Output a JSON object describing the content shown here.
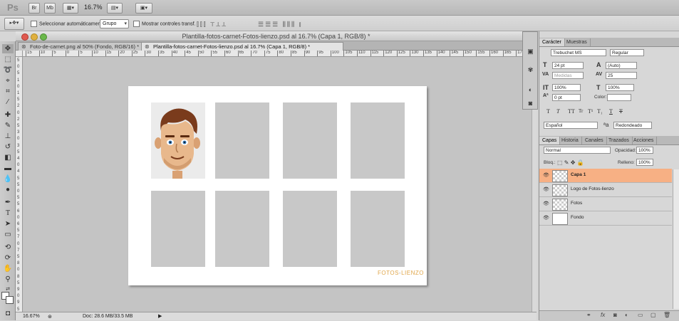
{
  "appbar": {
    "logo": "Ps",
    "br_button": "Br",
    "mb_button": "Mb",
    "zoom": "16.7%"
  },
  "options": {
    "auto_select_label": "Seleccionar automáticamente:",
    "group_value": "Grupo",
    "show_transform_label": "Mostrar controles transf."
  },
  "window": {
    "title": "Plantilla-fotos-carnet-Fotos-lienzo.psd al 16.7% (Capa 1, RGB/8) *"
  },
  "tabs": [
    {
      "label": "Foto-de-carnet.png al 50% (Fondo, RGB/16) *"
    },
    {
      "label": "Plantilla-fotos-carnet-Fotos-lienzo.psd al 16.7% (Capa 1, RGB/8) *"
    }
  ],
  "ruler": {
    "top": [
      "15",
      "10",
      "5",
      "0",
      "5",
      "10",
      "15",
      "20",
      "25",
      "30",
      "35",
      "40",
      "45",
      "50",
      "55",
      "60",
      "65",
      "70",
      "75",
      "80",
      "85",
      "90",
      "95",
      "100",
      "105",
      "110",
      "115",
      "120",
      "125",
      "130",
      "135",
      "140",
      "145",
      "150",
      "155",
      "160",
      "165",
      "170",
      "175"
    ],
    "left": [
      "5",
      "0",
      "5",
      "1",
      "0",
      "1",
      "5",
      "2",
      "0",
      "2",
      "5",
      "3",
      "0",
      "3",
      "5",
      "4",
      "0",
      "4",
      "5",
      "5",
      "0",
      "5",
      "5",
      "6",
      "0",
      "6",
      "5",
      "7",
      "0",
      "7",
      "5",
      "8",
      "0",
      "8",
      "5",
      "9",
      "0",
      "9",
      "5"
    ]
  },
  "document": {
    "logo_part1": "FOTOS",
    "logo_dash": "-",
    "logo_part2": "LIENZO"
  },
  "status": {
    "zoom": "16.67%",
    "doc_info": "Doc: 28.6 MB/33.5 MB"
  },
  "character": {
    "tabs": [
      "Carácter",
      "Muestras"
    ],
    "font_family": "Trebuchet MS",
    "font_style": "Regular",
    "font_size": "24 pt",
    "leading": "(Auto)",
    "kerning": "Medidas",
    "tracking": "25",
    "vscale": "100%",
    "hscale": "100%",
    "baseline": "0 pt",
    "color_label": "Color:",
    "language": "Español",
    "antialias": "Redondeado"
  },
  "layers": {
    "tabs": [
      "Capas",
      "Historia",
      "Canales",
      "Trazados",
      "Acciones"
    ],
    "blend_mode": "Normal",
    "opacity_label": "Opacidad:",
    "opacity": "100%",
    "lock_label": "Bloq.:",
    "fill_label": "Relleno:",
    "fill": "100%",
    "items": [
      {
        "name": "Capa 1",
        "selected": true
      },
      {
        "name": "Logo de Fotos-lienzo",
        "selected": false
      },
      {
        "name": "Fotos",
        "selected": false
      },
      {
        "name": "Fondo",
        "selected": false
      }
    ]
  },
  "colors": {
    "selected_layer": "#f7b084",
    "logo": "#e0a64a",
    "placeholder": "#c8c8c8"
  }
}
